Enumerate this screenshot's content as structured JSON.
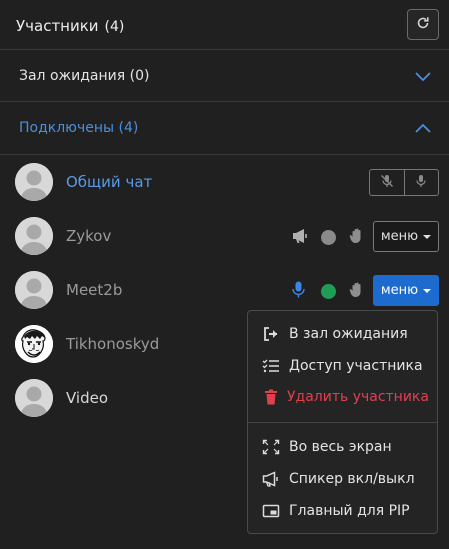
{
  "header": {
    "title": "Участники",
    "count": "(4)"
  },
  "sections": {
    "waiting": {
      "title": "Зал ожидания (0)"
    },
    "connected": {
      "title": "Подключены (4)"
    }
  },
  "participants": [
    {
      "name": "Общий чат"
    },
    {
      "name": "Zykov",
      "menu_label": "меню"
    },
    {
      "name": "Meet2b",
      "menu_label": "меню"
    },
    {
      "name": "Tikhonoskyd"
    },
    {
      "name": "Video"
    }
  ],
  "dropdown": {
    "items": [
      {
        "label": "В зал ожидания",
        "icon": "sign-out-icon"
      },
      {
        "label": "Доступ участника",
        "icon": "list-check-icon"
      },
      {
        "label": "Удалить участника",
        "icon": "trash-icon"
      },
      {
        "label": "Во весь экран",
        "icon": "expand-icon"
      },
      {
        "label": "Спикер вкл/выкл",
        "icon": "megaphone-icon"
      },
      {
        "label": "Главный для PIP",
        "icon": "pip-icon"
      }
    ]
  },
  "colors": {
    "background": "#202020",
    "accent_blue": "#1e6bd0",
    "link_blue": "#4a8fde",
    "status_green": "#1f9d55",
    "status_gray": "#8a8a8a",
    "danger_red": "#e0404e"
  }
}
